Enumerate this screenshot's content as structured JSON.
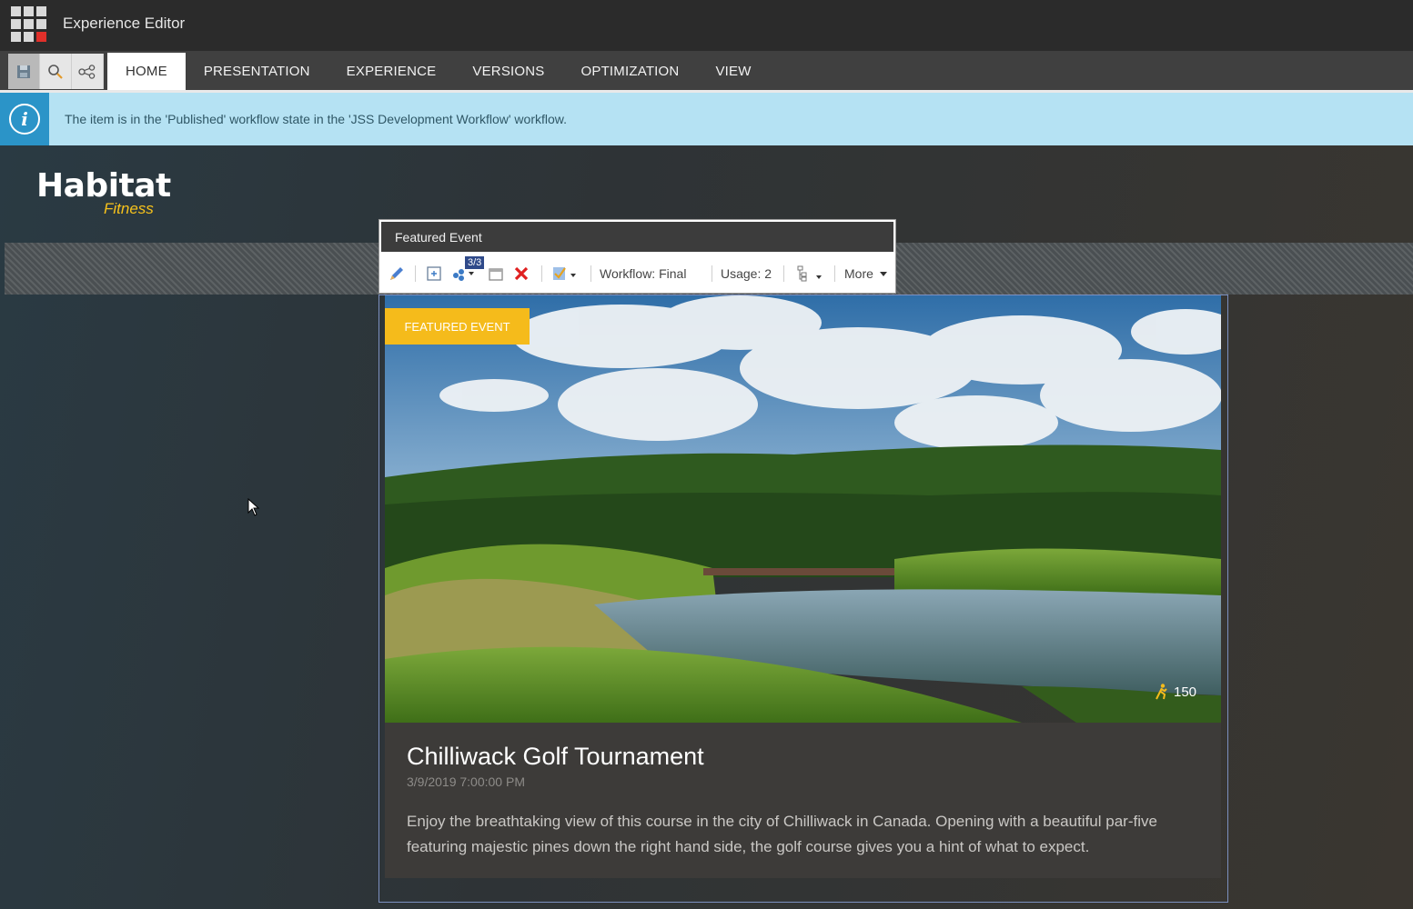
{
  "app": {
    "title": "Experience Editor"
  },
  "ribbon": {
    "tabs": [
      {
        "label": "HOME",
        "active": true
      },
      {
        "label": "PRESENTATION"
      },
      {
        "label": "EXPERIENCE"
      },
      {
        "label": "VERSIONS"
      },
      {
        "label": "OPTIMIZATION"
      },
      {
        "label": "VIEW"
      }
    ],
    "quick_actions": [
      "save-icon",
      "search-icon",
      "share-icon"
    ]
  },
  "notification": {
    "text": "The item is in the 'Published' workflow state in the 'JSS Development Workflow' workflow."
  },
  "logo": {
    "main": "Habitat",
    "sub": "Fitness"
  },
  "component_toolbar": {
    "title": "Featured Event",
    "datasource_count": "3/3",
    "workflow": "Workflow: Final",
    "usage": "Usage: 2",
    "more": "More"
  },
  "event": {
    "badge": "FEATURED EVENT",
    "attendees": "150",
    "title": "Chilliwack Golf Tournament",
    "date": "3/9/2019 7:00:00 PM",
    "description": "Enjoy the breathtaking view of this course in the city of Chilliwack in Canada. Opening with a beautiful par-five featuring majestic pines down the right hand side, the golf course gives you a hint of what to expect."
  },
  "colors": {
    "accent": "#f5bb1b",
    "info": "#b5e2f3",
    "info_icon": "#2b94c8"
  }
}
